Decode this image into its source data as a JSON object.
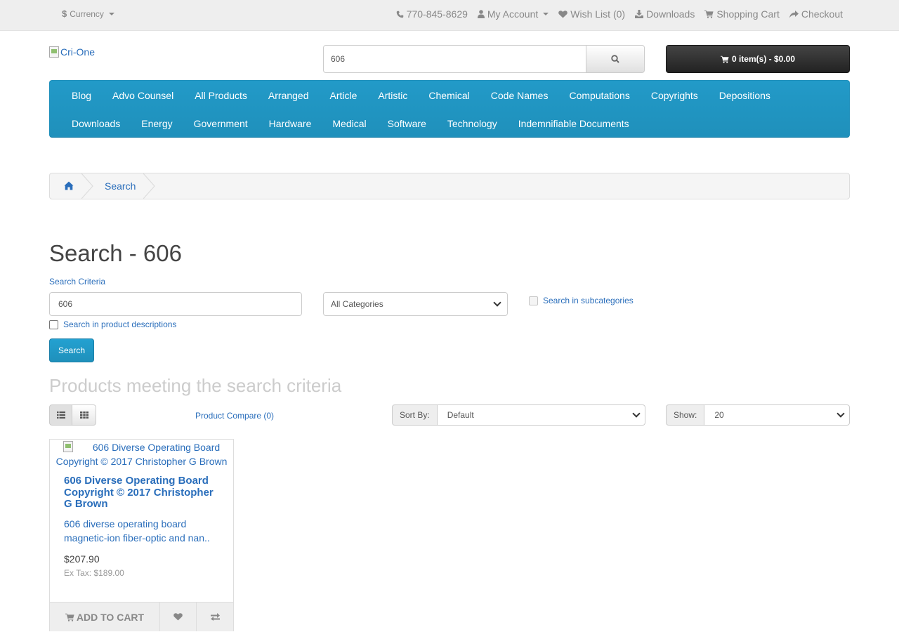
{
  "top_bar": {
    "currency_symbol": "$",
    "currency_label": "Currency",
    "phone": "770-845-8629",
    "my_account": "My Account",
    "wish_list": "Wish List (0)",
    "downloads": "Downloads",
    "shopping_cart": "Shopping Cart",
    "checkout": "Checkout"
  },
  "header": {
    "logo_alt": "Cri-One",
    "search_value": "606",
    "cart_label": "0 item(s) - $0.00"
  },
  "menu": {
    "row1": [
      "Blog",
      "Advo Counsel",
      "All Products",
      "Arranged",
      "Article",
      "Artistic",
      "Chemical",
      "Code Names",
      "Computations",
      "Copyrights",
      "Depositions"
    ],
    "row2": [
      "Downloads",
      "Energy",
      "Government",
      "Hardware",
      "Medical",
      "Software",
      "Technology",
      "Indemnifiable Documents"
    ]
  },
  "breadcrumb": {
    "current": "Search"
  },
  "page": {
    "title": "Search - 606",
    "criteria_label": "Search Criteria",
    "criteria_value": "606",
    "category_selected": "All Categories",
    "subcategories_label": "Search in subcategories",
    "descriptions_label": "Search in product descriptions",
    "search_button": "Search",
    "results_heading": "Products meeting the search criteria",
    "compare_link": "Product Compare (0)",
    "sort_label": "Sort By:",
    "sort_value": "Default",
    "show_label": "Show:",
    "show_value": "20"
  },
  "product": {
    "image_alt": "606 Diverse Operating Board Copyright © 2017 Christopher G Brown",
    "name": "606 Diverse Operating Board Copyright © 2017 Christopher G Brown",
    "description": "606 diverse operating board magnetic-ion fiber-optic and nan..",
    "price": "$207.90",
    "ex_tax": "Ex Tax: $189.00",
    "add_to_cart": "ADD TO CART"
  },
  "colors": {
    "accent": "#229ac8",
    "link": "#2a6ebb",
    "cart_button": "#2b2b2b",
    "top_bar_bg": "#eeeeee"
  },
  "icons": [
    "phone-icon",
    "user-icon",
    "heart-icon",
    "download-icon",
    "cart-icon",
    "share-icon",
    "search-icon",
    "home-icon",
    "list-icon",
    "grid-icon",
    "compare-icon"
  ]
}
